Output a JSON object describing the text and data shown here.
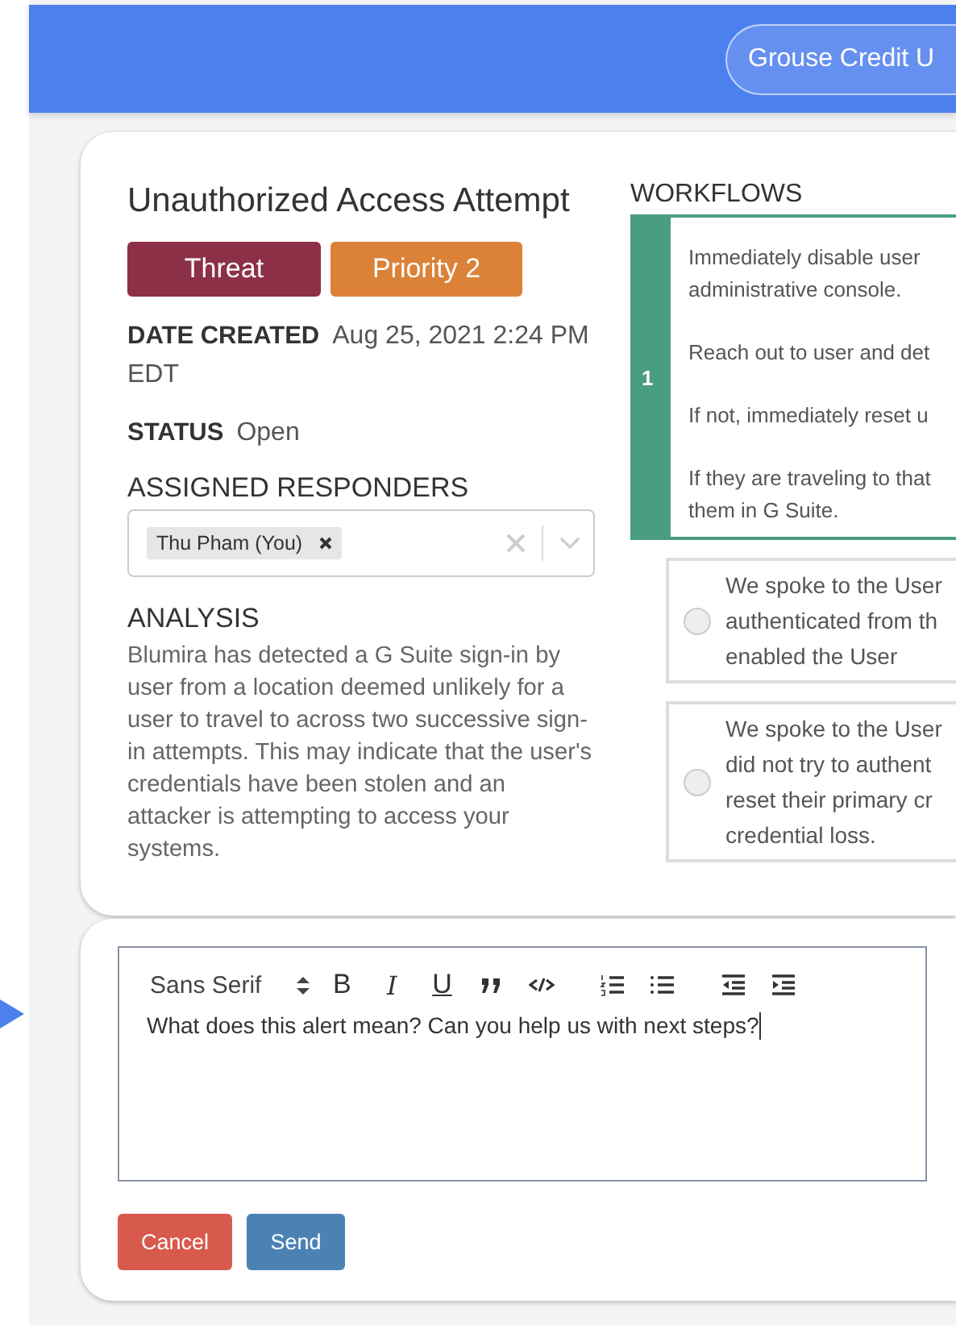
{
  "header": {
    "org_button": "Grouse Credit U"
  },
  "alert": {
    "title": "Unauthorized Access Attempt",
    "tags": [
      {
        "label": "Threat",
        "color": "#8c3047"
      },
      {
        "label": "Priority 2",
        "color": "#db8238"
      }
    ],
    "date_label": "DATE CREATED",
    "date_value": "Aug 25, 2021 2:24 PM EDT",
    "status_label": "STATUS",
    "status_value": "Open",
    "responders_label": "ASSIGNED RESPONDERS",
    "responders": [
      {
        "name": "Thu Pham (You)"
      }
    ],
    "analysis_label": "ANALYSIS",
    "analysis_text": "Blumira has detected a G Suite sign-in by user from a location deemed unlikely for a user to travel to across two successive sign-in attempts. This may indicate that the user's credentials have been stolen and an attacker is attempting to access your systems."
  },
  "workflows": {
    "title": "WORKFLOWS",
    "steps": [
      {
        "number": "1",
        "paragraphs": [
          [
            "Immediately disable user",
            "administrative console."
          ],
          [
            "Reach out to user and det"
          ],
          [
            "If not, immediately reset u"
          ],
          [
            "If they are traveling to that",
            "them in G Suite."
          ]
        ]
      }
    ],
    "options": [
      {
        "lines": [
          "We spoke to the User",
          "authenticated from th",
          "enabled the User"
        ],
        "selected": false
      },
      {
        "lines": [
          "We spoke to the User",
          "did not try to authent",
          "reset their primary cr",
          "credential loss."
        ],
        "selected": false
      }
    ]
  },
  "comment": {
    "font": "Sans Serif",
    "toolbar": [
      {
        "kind": "bold",
        "label": "B"
      },
      {
        "kind": "italic",
        "label": "I"
      },
      {
        "kind": "underline",
        "label": "U"
      },
      {
        "kind": "quote"
      },
      {
        "kind": "code"
      },
      {
        "kind": "ordered-list"
      },
      {
        "kind": "bullet-list"
      },
      {
        "kind": "outdent"
      },
      {
        "kind": "indent"
      }
    ],
    "text": "What does this alert mean? Can you help us with next steps?",
    "buttons": [
      {
        "label": "Cancel",
        "kind": "cancel"
      },
      {
        "label": "Send",
        "kind": "send"
      }
    ]
  }
}
